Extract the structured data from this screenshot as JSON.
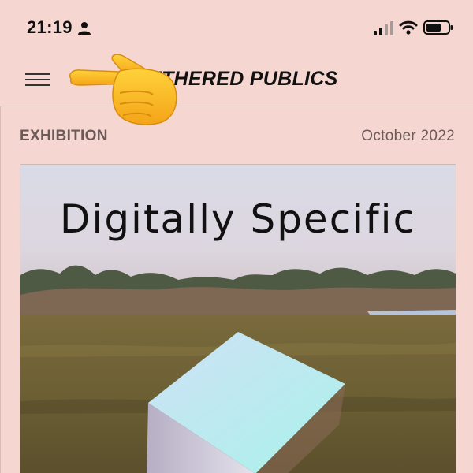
{
  "status_bar": {
    "time": "21:19"
  },
  "header": {
    "title": "ETHERED PUBLICS"
  },
  "article": {
    "category": "EXHIBITION",
    "date": "October 2022",
    "feature_title": "Digitally Specific"
  },
  "colors": {
    "background": "#f6d6d0",
    "text": "#111111",
    "meta_text": "#6b5a57"
  },
  "icons": [
    "person-icon",
    "signal-icon",
    "wifi-icon",
    "battery-icon",
    "menu-icon",
    "pointing-hand-icon"
  ]
}
